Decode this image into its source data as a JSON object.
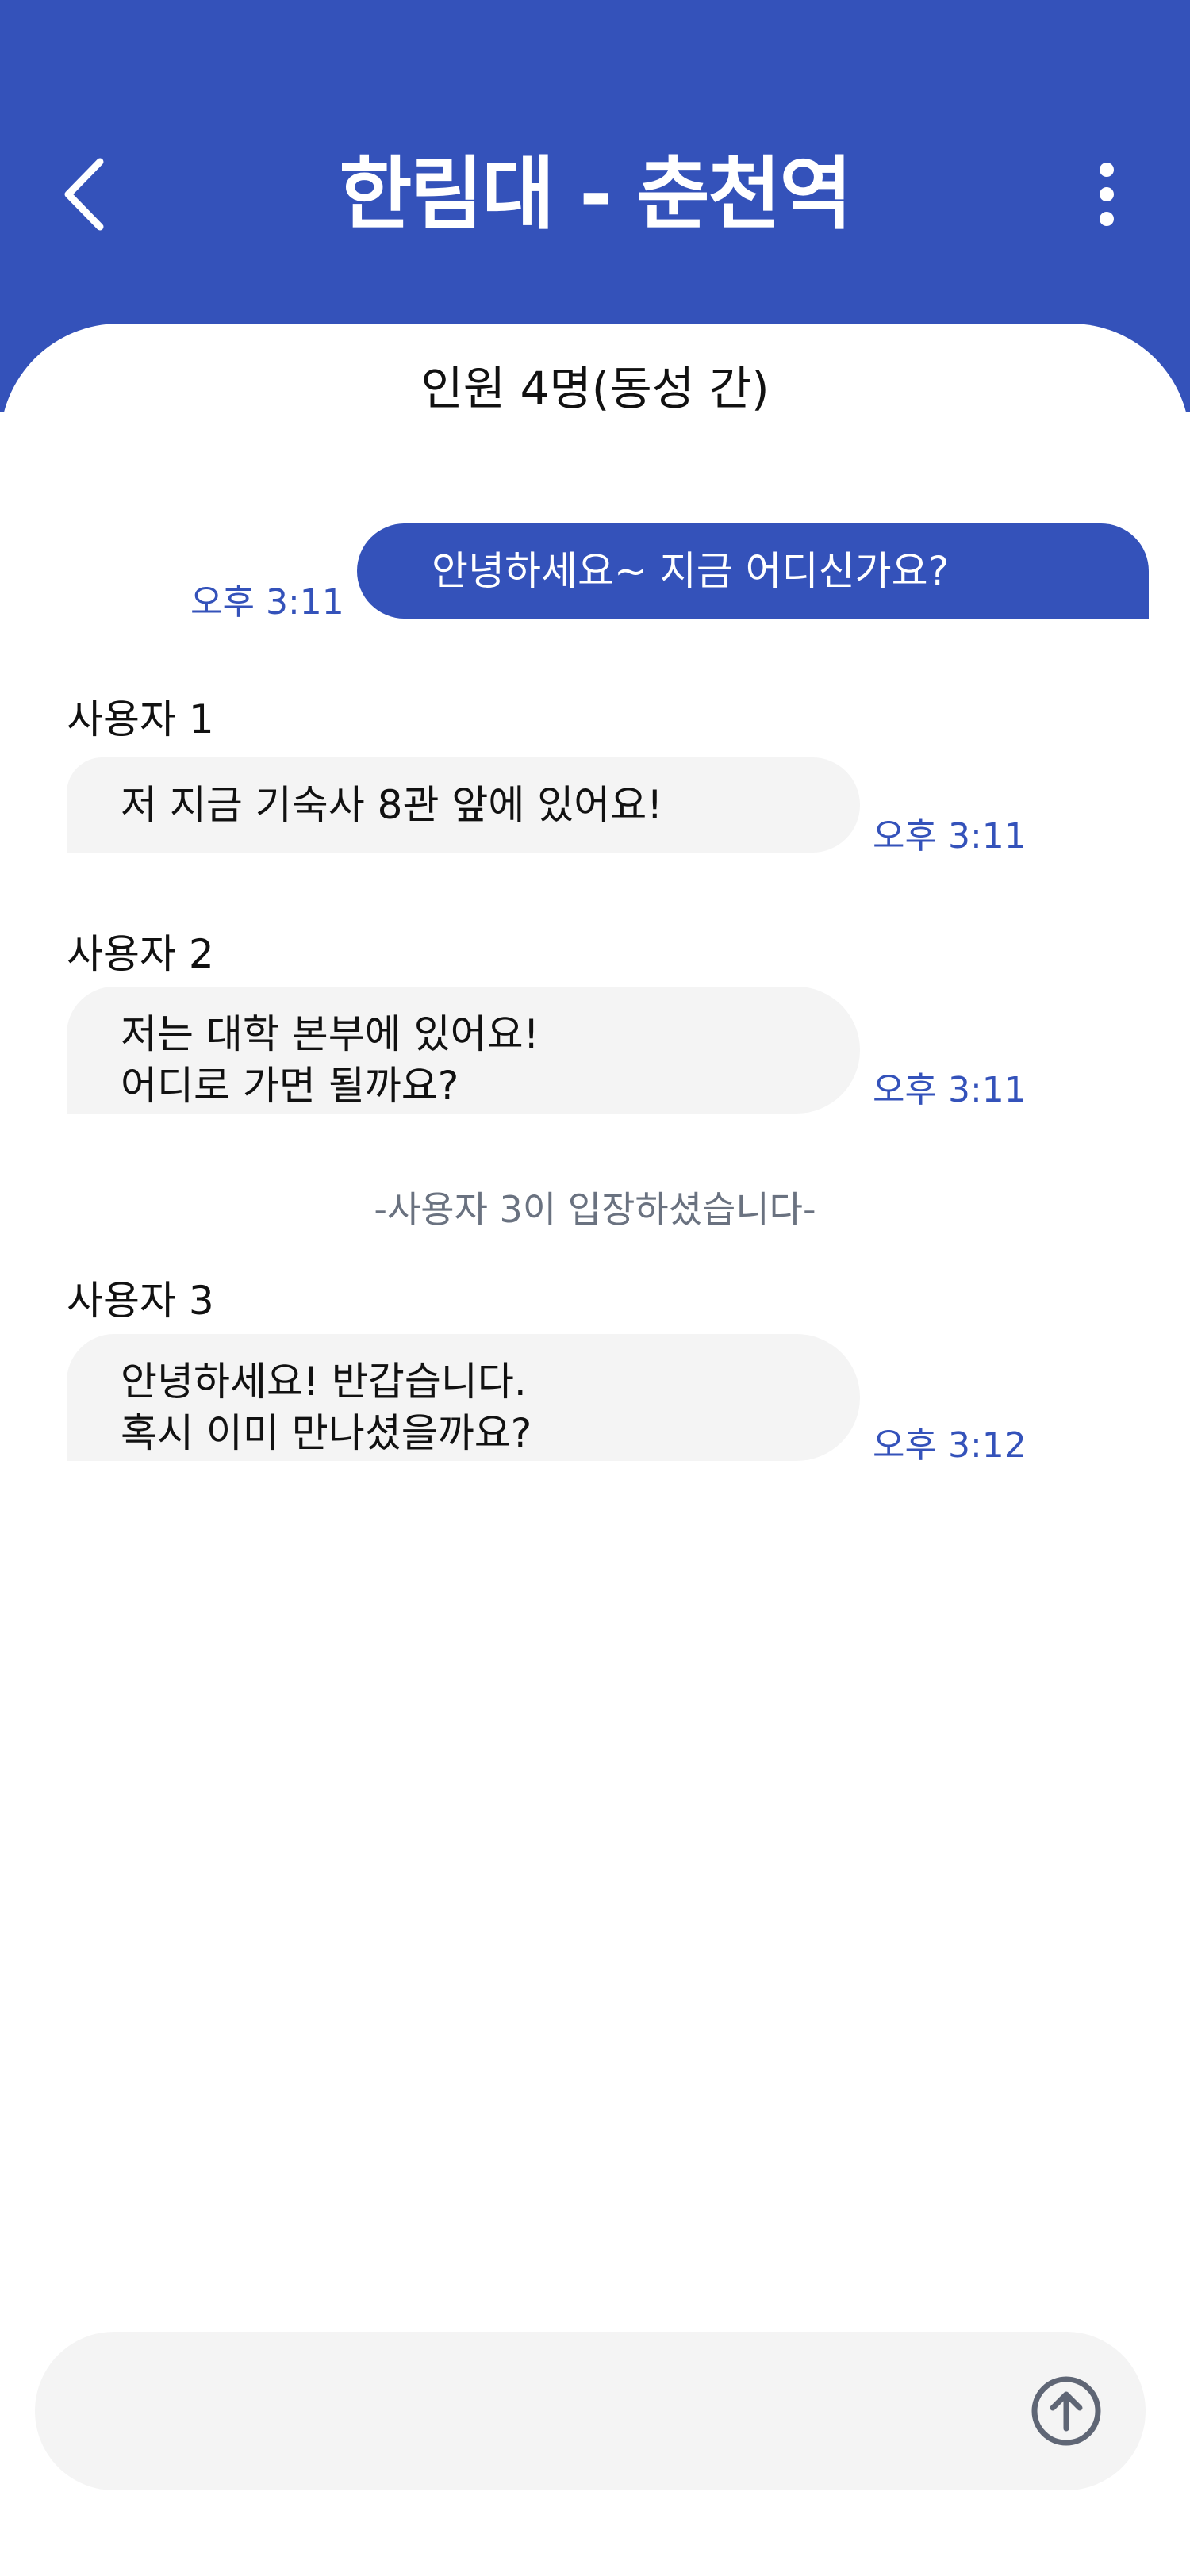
{
  "header": {
    "title": "한림대 - 춘천역",
    "back_icon": "chevron-left-icon",
    "more_icon": "more-vertical-icon",
    "background_color": "#3452BA"
  },
  "room": {
    "subtitle": "인원 4명(동성 간)"
  },
  "messages": [
    {
      "type": "outgoing",
      "text": "안녕하세요~  지금 어디신가요?",
      "time": "오후 3:11"
    },
    {
      "type": "incoming",
      "sender": "사용자 1",
      "lines": [
        "저 지금 기숙사 8관 앞에 있어요!"
      ],
      "time": "오후 3:11"
    },
    {
      "type": "incoming",
      "sender": "사용자 2",
      "lines": [
        "저는 대학 본부에 있어요!",
        "어디로 가면 될까요?"
      ],
      "time": "오후 3:11"
    },
    {
      "type": "system",
      "text": "-사용자 3이 입장하셨습니다-"
    },
    {
      "type": "incoming",
      "sender": "사용자 3",
      "lines": [
        "안녕하세요! 반갑습니다.",
        "혹시 이미 만나셨을까요?"
      ],
      "time": "오후 3:12"
    }
  ],
  "composer": {
    "value": "",
    "placeholder": "",
    "send_icon": "arrow-up-circle-icon"
  },
  "colors": {
    "accent": "#3452BA",
    "bubble_incoming": "#F4F4F4",
    "system_text": "#6A7280"
  }
}
